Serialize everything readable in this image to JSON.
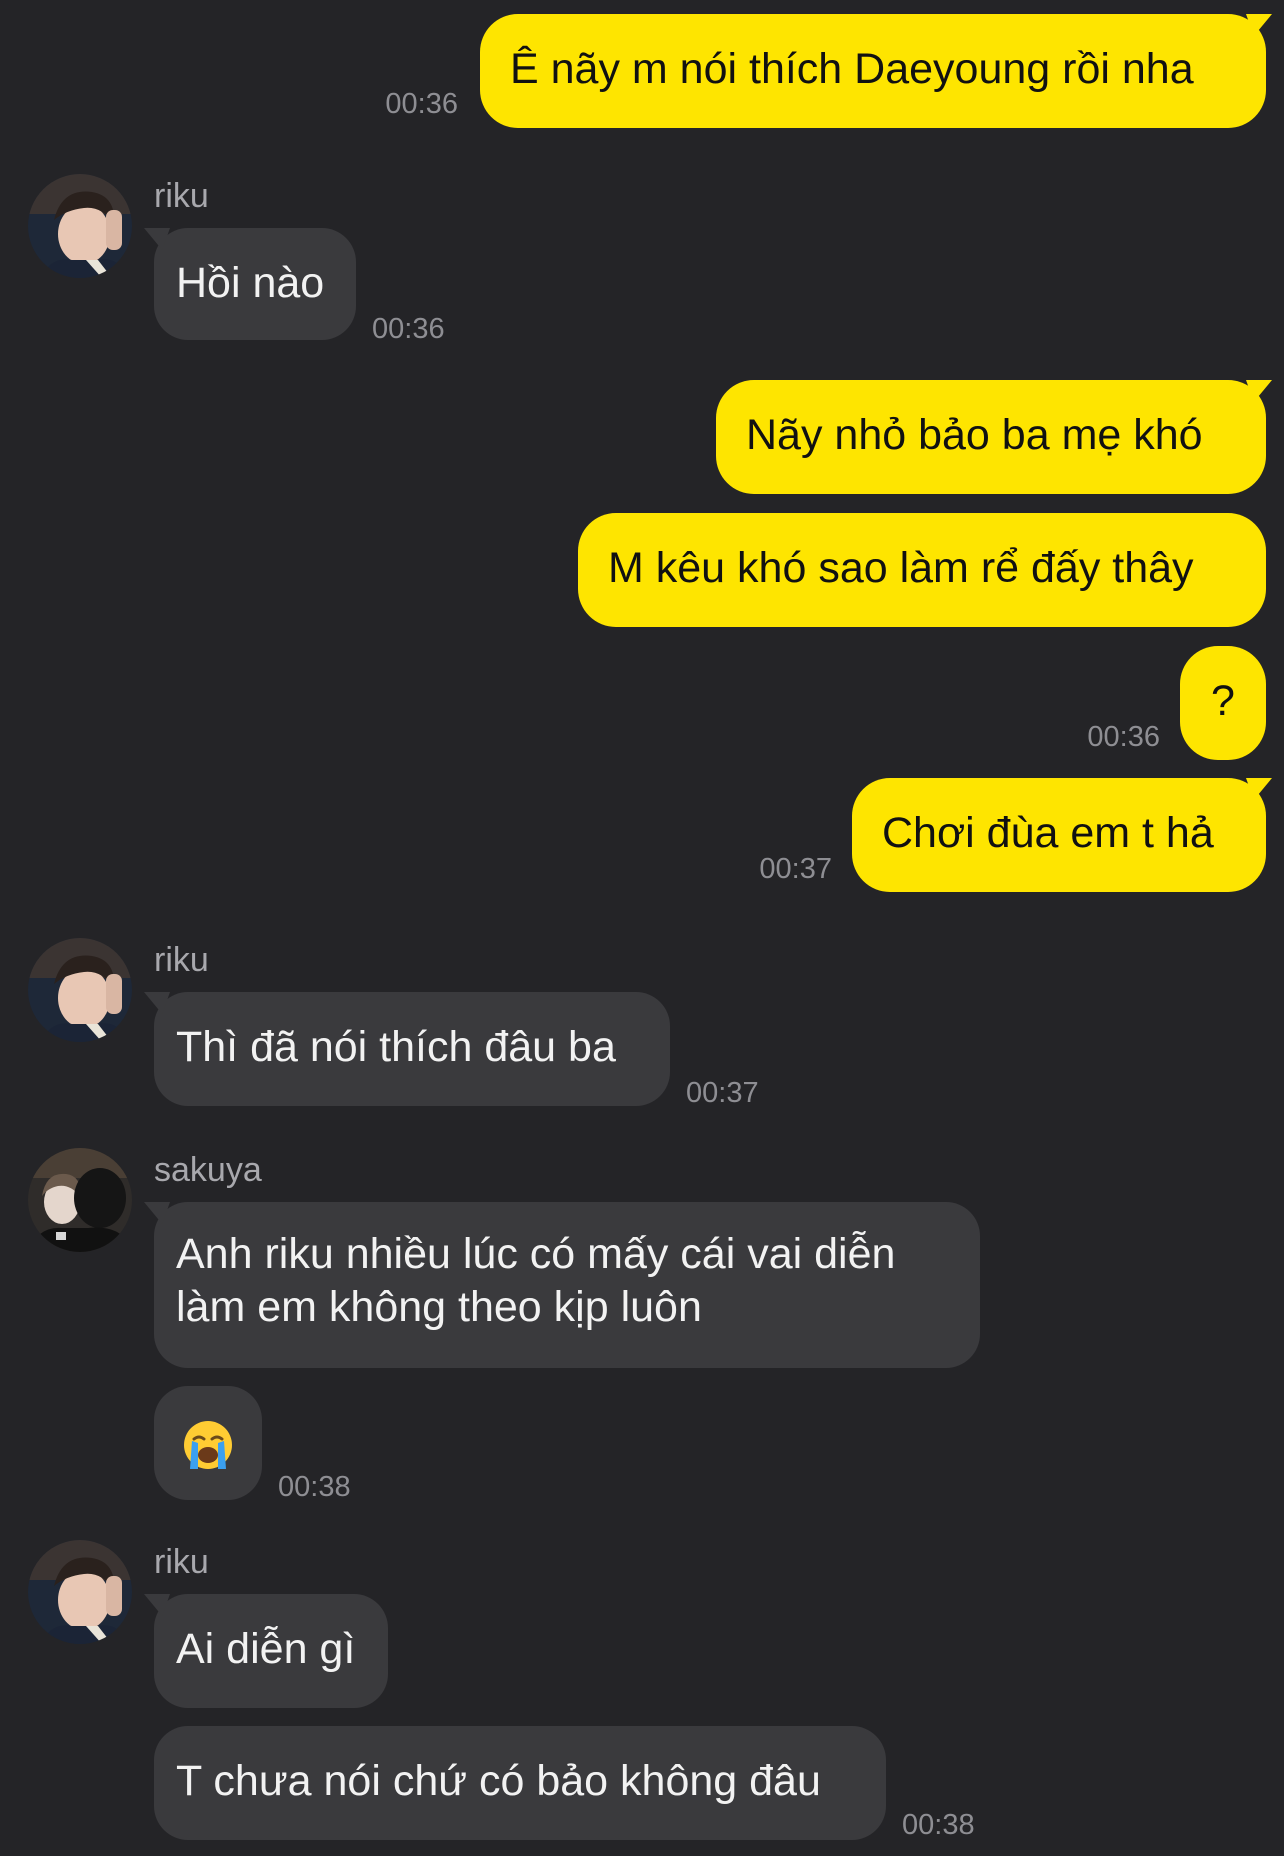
{
  "chat": {
    "messages": [
      {
        "sender": "me",
        "text": "Ê nãy m nói thích Daeyoung rồi nha",
        "time": "00:36"
      },
      {
        "sender": "riku",
        "text": "Hồi nào",
        "time": "00:36"
      },
      {
        "sender": "me",
        "text": "Nãy nhỏ bảo ba mẹ khó"
      },
      {
        "sender": "me",
        "text": "M kêu khó sao làm rể đấy thây"
      },
      {
        "sender": "me",
        "text": "?",
        "time": "00:36"
      },
      {
        "sender": "me",
        "text": "Chơi đùa em t hả",
        "time": "00:37"
      },
      {
        "sender": "riku",
        "text": "Thì đã nói thích đâu ba",
        "time": "00:37"
      },
      {
        "sender": "sakuya",
        "text": "Anh riku nhiều lúc có mấy cái vai diễn làm em không theo kịp luôn"
      },
      {
        "sender": "sakuya",
        "emoji": "loudly-crying-face",
        "time": "00:38"
      },
      {
        "sender": "riku",
        "text": "Ai diễn gì"
      },
      {
        "sender": "riku",
        "text": "T chưa nói chứ có bảo không đâu",
        "time": "00:38"
      }
    ],
    "senders": {
      "riku": "riku",
      "sakuya": "sakuya"
    }
  },
  "colors": {
    "background": "#242427",
    "my_bubble": "#fee500",
    "their_bubble": "#3a3a3d",
    "time_text": "#8e8e93",
    "sender_name": "#a8a8ad"
  }
}
